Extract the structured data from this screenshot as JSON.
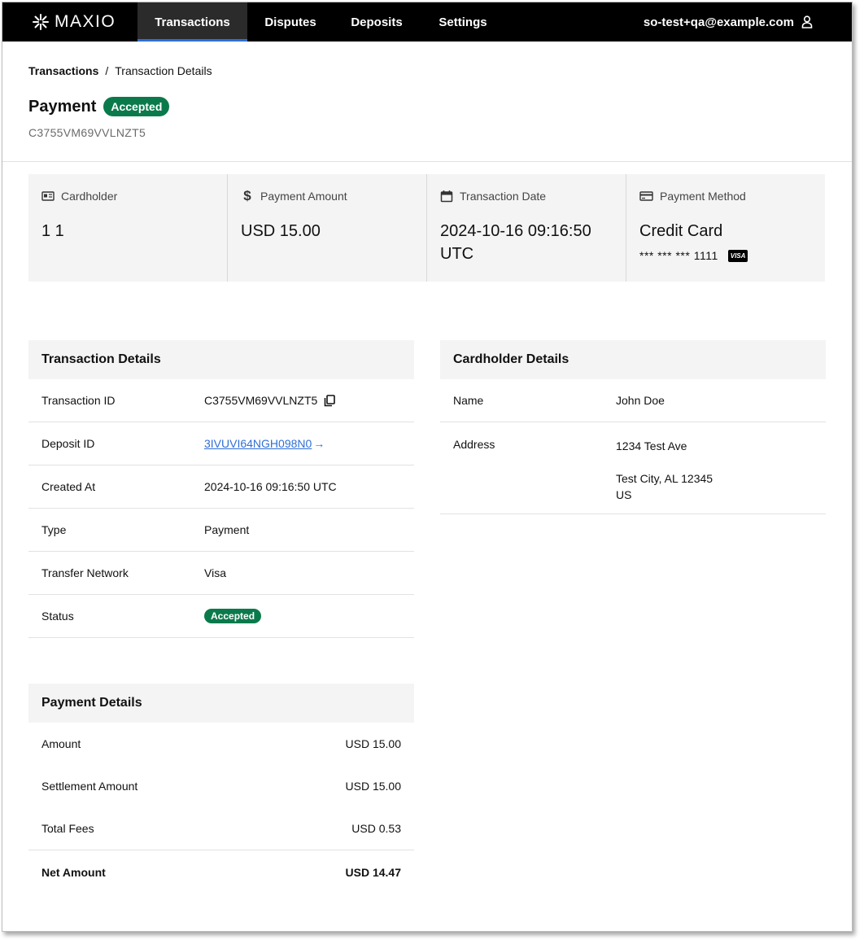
{
  "nav": {
    "brand": "MAXIO",
    "tabs": [
      "Transactions",
      "Disputes",
      "Deposits",
      "Settings"
    ],
    "user_email": "so-test+qa@example.com"
  },
  "breadcrumb": {
    "parent": "Transactions",
    "separator": "/",
    "current": "Transaction Details"
  },
  "header": {
    "title": "Payment",
    "status": "Accepted",
    "transaction_id": "C3755VM69VVLNZT5"
  },
  "summary": {
    "cardholder": {
      "label": "Cardholder",
      "value": "1 1"
    },
    "amount": {
      "label": "Payment Amount",
      "value": "USD 15.00"
    },
    "date": {
      "label": "Transaction Date",
      "value": "2024-10-16 09:16:50 UTC"
    },
    "method": {
      "label": "Payment Method",
      "value": "Credit Card",
      "masked": "*** *** *** 1111",
      "brand": "VISA"
    }
  },
  "transaction_details": {
    "title": "Transaction Details",
    "rows": [
      {
        "label": "Transaction ID",
        "value": "C3755VM69VVLNZT5"
      },
      {
        "label": "Deposit ID",
        "value": "3IVUVI64NGH098N0"
      },
      {
        "label": "Created At",
        "value": "2024-10-16 09:16:50 UTC"
      },
      {
        "label": "Type",
        "value": "Payment"
      },
      {
        "label": "Transfer Network",
        "value": "Visa"
      },
      {
        "label": "Status",
        "value": "Accepted"
      }
    ]
  },
  "cardholder_details": {
    "title": "Cardholder Details",
    "name_label": "Name",
    "name": "John Doe",
    "address_label": "Address",
    "address_line1": "1234 Test Ave",
    "address_city": "Test City, AL 12345",
    "address_country": "US"
  },
  "payment_details": {
    "title": "Payment Details",
    "rows": [
      {
        "label": "Amount",
        "value": "USD 15.00"
      },
      {
        "label": "Settlement Amount",
        "value": "USD 15.00"
      },
      {
        "label": "Total Fees",
        "value": "USD 0.53"
      }
    ],
    "net_label": "Net Amount",
    "net_value": "USD 14.47"
  },
  "colors": {
    "accent": "#2f6fd6",
    "status_green": "#0b7a4b",
    "nav_bg": "#000000"
  }
}
